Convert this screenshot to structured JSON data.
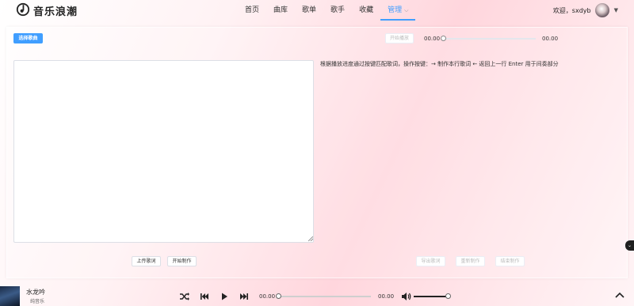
{
  "app": {
    "name": "音乐浪潮"
  },
  "nav": {
    "items": [
      {
        "label": "首页"
      },
      {
        "label": "曲库"
      },
      {
        "label": "歌单"
      },
      {
        "label": "歌手"
      },
      {
        "label": "收藏"
      },
      {
        "label": "管理",
        "active": true
      }
    ]
  },
  "user": {
    "welcome": "欢迎，sxdyb"
  },
  "editor": {
    "select_song": "选择歌曲",
    "start_play": "开始播放",
    "time_current": "00.00",
    "time_total": "00.00",
    "progress": 0,
    "lyrics_value": "",
    "hint": "根据播放进度通过按键匹配歌词，操作按键：→ 制作本行歌词 ← 返回上一行 Enter 用于间奏部分",
    "upload_lyrics": "上传歌词",
    "start_make": "开始制作",
    "export_lyrics": "导出歌词",
    "remake": "重新制作",
    "finish_make": "结束制作"
  },
  "player": {
    "song_title": "水龙吟",
    "song_artist": "纯音乐",
    "time_current": "00.00",
    "time_total": "00.00",
    "progress": 0,
    "volume": 0.9
  },
  "icons": {
    "logo": "music-note-icon",
    "shuffle": "shuffle-icon",
    "prev": "skip-previous-icon",
    "play": "play-icon",
    "next": "skip-next-icon",
    "volume": "volume-icon",
    "expand": "chevron-up-icon"
  },
  "colors": {
    "accent": "#409eff",
    "text": "#333333"
  }
}
